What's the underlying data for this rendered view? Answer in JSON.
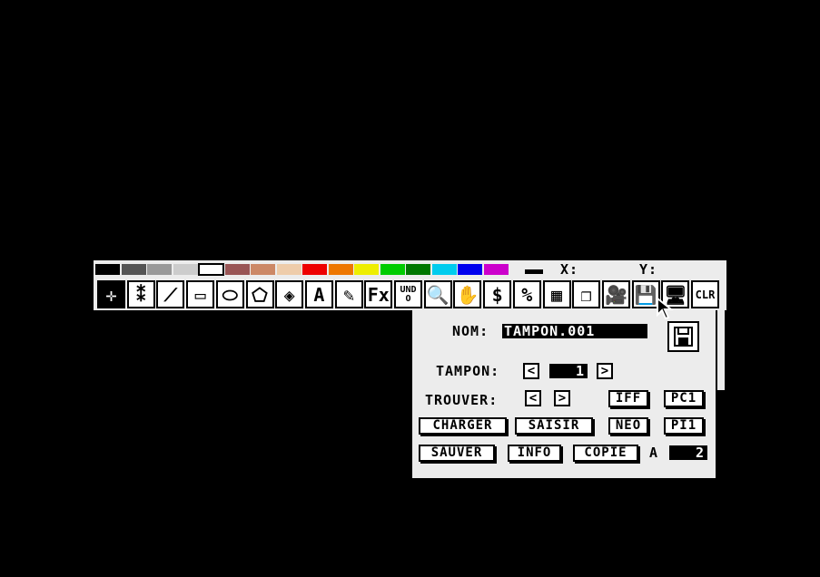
{
  "palette": {
    "colors": [
      "#000000",
      "#555555",
      "#999999",
      "#cccccc",
      "#ffffff",
      "#995555",
      "#cc8866",
      "#eeccaa",
      "#ee0000",
      "#ee7700",
      "#eeee00",
      "#00cc00",
      "#007700",
      "#00ccee",
      "#0000ee",
      "#cc00cc"
    ],
    "selected_index": 4
  },
  "coords": {
    "x_label": "X:",
    "y_label": "Y:"
  },
  "toolbar": {
    "tools": [
      {
        "name": "crosshair-tool",
        "glyph": "✛"
      },
      {
        "name": "spray-tool",
        "glyph": "⁑"
      },
      {
        "name": "line-tool",
        "glyph": "⟋"
      },
      {
        "name": "rectangle-tool",
        "glyph": "▭"
      },
      {
        "name": "ellipse-tool",
        "glyph": "⬭"
      },
      {
        "name": "polygon-tool",
        "glyph": "⬠"
      },
      {
        "name": "fill-tool",
        "glyph": "◈"
      },
      {
        "name": "text-tool",
        "glyph": "A"
      },
      {
        "name": "brush-tool",
        "glyph": "✎"
      },
      {
        "name": "effects-tool",
        "glyph": "Fx"
      },
      {
        "name": "undo-tool",
        "glyph": "UNDO"
      },
      {
        "name": "zoom-tool",
        "glyph": "🔍"
      },
      {
        "name": "hand-tool",
        "glyph": "✋"
      },
      {
        "name": "dollar-tool",
        "glyph": "$"
      },
      {
        "name": "percent-tool",
        "glyph": "%"
      },
      {
        "name": "grid-tool",
        "glyph": "▦"
      },
      {
        "name": "windows-tool",
        "glyph": "❐"
      },
      {
        "name": "camera-tool",
        "glyph": "🎥"
      },
      {
        "name": "disk-tool",
        "glyph": "💾"
      },
      {
        "name": "computer-tool",
        "glyph": "🖥"
      },
      {
        "name": "clear-tool",
        "glyph": "CLR"
      }
    ],
    "active_index": 0
  },
  "file_panel": {
    "nom_label": "NOM:",
    "nom_value": "TAMPON.001",
    "tampon_label": "TAMPON:",
    "tampon_value": "1",
    "trouver_label": "TROUVER:",
    "prev_arrow": "<",
    "next_arrow": ">",
    "iff": "IFF",
    "pc1": "PC1",
    "charger": "CHARGER",
    "saisir": "SAISIR",
    "neo": "NEO",
    "pi1": "PI1",
    "sauver": "SAUVER",
    "info": "INFO",
    "copie": "COPIE",
    "a_label": "A",
    "copy_value": "2"
  }
}
